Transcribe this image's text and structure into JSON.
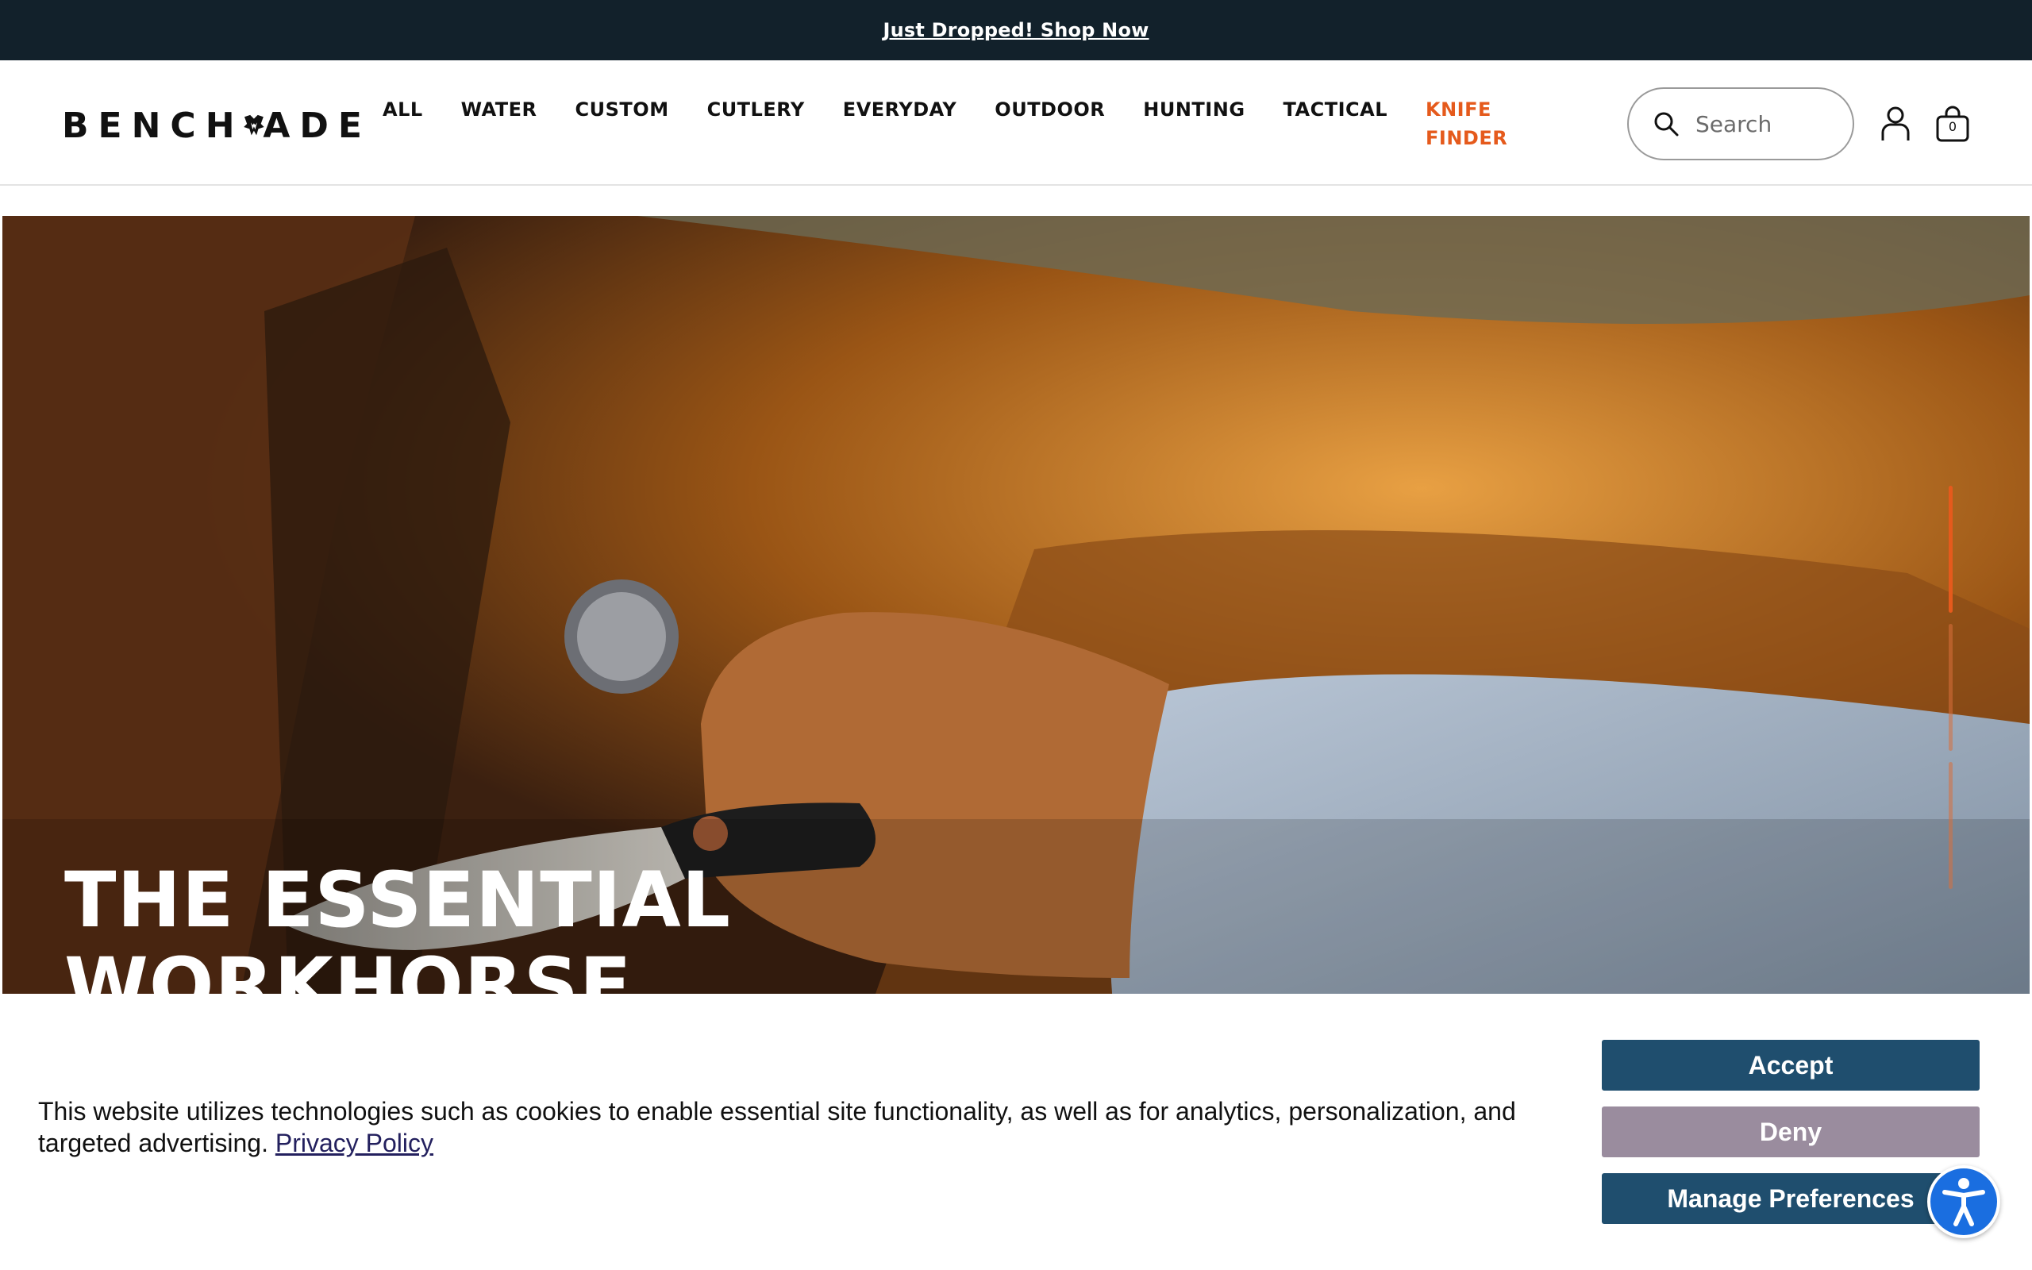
{
  "announcement": {
    "text": "Just Dropped! Shop Now"
  },
  "brand": {
    "logo_text_left": "BENCH",
    "logo_text_right": "ADE",
    "logo_alt": "Benchmade"
  },
  "nav": {
    "items": [
      "ALL",
      "WATER",
      "CUSTOM",
      "CUTLERY",
      "EVERYDAY",
      "OUTDOOR",
      "HUNTING",
      "TACTICAL"
    ],
    "accent_item": "KNIFE FINDER",
    "accent_color": "#e55a1c"
  },
  "search": {
    "placeholder": "Search",
    "icon": "search-icon"
  },
  "account": {
    "icon": "user-icon"
  },
  "cart": {
    "icon": "shopping-bag-icon",
    "count": "0"
  },
  "hero": {
    "title_line1": "THE ESSENTIAL",
    "title_line2": "WORKHORSE",
    "slides_total": 3,
    "active_slide": 1,
    "indicator_active_color": "#e55a1c"
  },
  "cookie_banner": {
    "text": "This website utilizes technologies such as cookies to enable essential site functionality, as well as for analytics, personalization, and targeted advertising.",
    "link_text": "Privacy Policy",
    "accept_label": "Accept",
    "deny_label": "Deny",
    "manage_label": "Manage Preferences",
    "accept_color": "#1f4e6e",
    "deny_color": "#9a8c9e",
    "manage_color": "#1f4e6e"
  },
  "accessibility": {
    "icon": "accessibility-icon"
  }
}
